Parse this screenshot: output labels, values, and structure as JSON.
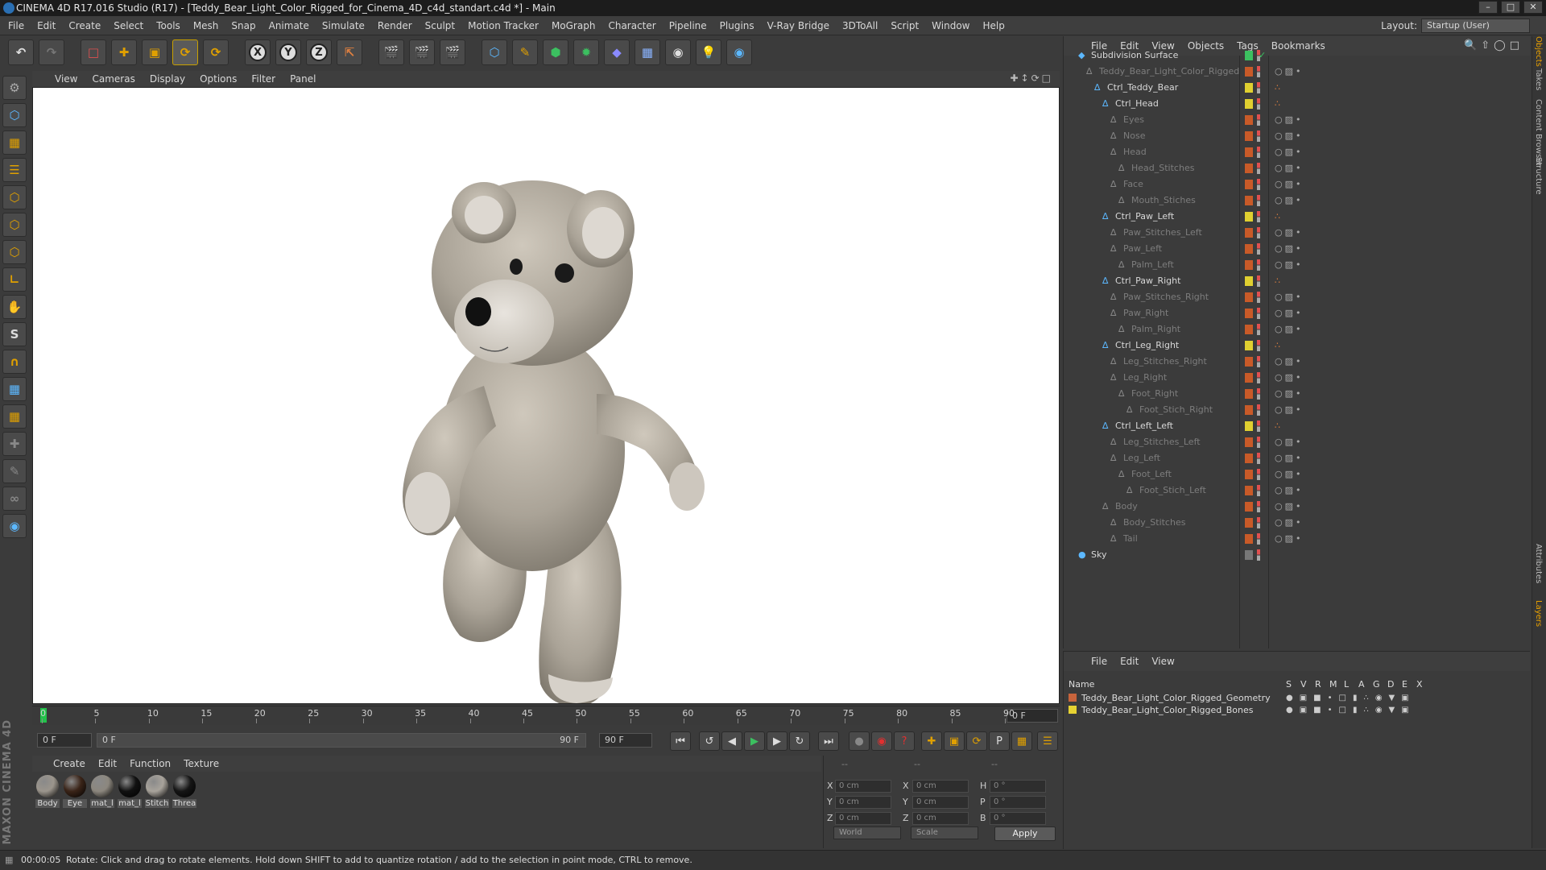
{
  "window": {
    "title": "CINEMA 4D R17.016 Studio (R17) - [Teddy_Bear_Light_Color_Rigged_for_Cinema_4D_c4d_standart.c4d *] - Main"
  },
  "menubar": {
    "items": [
      "File",
      "Edit",
      "Create",
      "Select",
      "Tools",
      "Mesh",
      "Snap",
      "Animate",
      "Simulate",
      "Render",
      "Sculpt",
      "Motion Tracker",
      "MoGraph",
      "Character",
      "Pipeline",
      "Plugins",
      "V-Ray Bridge",
      "3DToAll",
      "Script",
      "Window",
      "Help"
    ],
    "layout_label": "Layout:",
    "layout_value": "Startup (User)"
  },
  "toolbar": {
    "x_label": "X",
    "y_label": "Y",
    "z_label": "Z"
  },
  "viewport": {
    "menu": [
      "View",
      "Cameras",
      "Display",
      "Options",
      "Filter",
      "Panel"
    ]
  },
  "timeline": {
    "ticks": [
      "0",
      "5",
      "10",
      "15",
      "20",
      "25",
      "30",
      "35",
      "40",
      "45",
      "50",
      "55",
      "60",
      "65",
      "70",
      "75",
      "80",
      "85",
      "90"
    ],
    "current_frame": "0 F"
  },
  "transport": {
    "start_field": "0 F",
    "range_start": "0 F",
    "range_end": "90 F",
    "end_field": "90 F"
  },
  "material_manager": {
    "menu": [
      "Create",
      "Edit",
      "Function",
      "Texture"
    ],
    "materials": [
      {
        "label": "Body",
        "color": "#9b958c"
      },
      {
        "label": "Eye",
        "color": "#3a2418"
      },
      {
        "label": "mat_l",
        "color": "#8c877e"
      },
      {
        "label": "mat_l",
        "color": "#111111"
      },
      {
        "label": "Stitch",
        "color": "#a8a39b"
      },
      {
        "label": "Threa",
        "color": "#151515"
      }
    ]
  },
  "coordinates": {
    "header": [
      "--",
      "--",
      "--"
    ],
    "rows": [
      {
        "axis": "X",
        "pos": "0 cm",
        "size_axis": "X",
        "size": "0 cm",
        "rot_axis": "H",
        "rot": "0 °"
      },
      {
        "axis": "Y",
        "pos": "0 cm",
        "size_axis": "Y",
        "size": "0 cm",
        "rot_axis": "P",
        "rot": "0 °"
      },
      {
        "axis": "Z",
        "pos": "0 cm",
        "size_axis": "Z",
        "size": "0 cm",
        "rot_axis": "B",
        "rot": "0 °"
      }
    ],
    "mode_select": "World",
    "scale_select": "Scale",
    "apply_label": "Apply"
  },
  "object_manager": {
    "menu": [
      "File",
      "Edit",
      "View",
      "Objects",
      "Tags",
      "Bookmarks"
    ],
    "objects": [
      {
        "name": "Subdivision Surface",
        "state": "on",
        "tag": "green"
      },
      {
        "name": "Teddy_Bear_Light_Color_Rigged",
        "state": "dim",
        "tag": "orange"
      },
      {
        "name": "Ctrl_Teddy_Bear",
        "state": "on",
        "tag": "yellow"
      },
      {
        "name": "Ctrl_Head",
        "state": "on",
        "tag": "yellow"
      },
      {
        "name": "Eyes",
        "state": "dim",
        "tag": "orange"
      },
      {
        "name": "Nose",
        "state": "dim",
        "tag": "orange"
      },
      {
        "name": "Head",
        "state": "dim",
        "tag": "orange"
      },
      {
        "name": "Head_Stitches",
        "state": "dim",
        "tag": "orange"
      },
      {
        "name": "Face",
        "state": "dim",
        "tag": "orange"
      },
      {
        "name": "Mouth_Stiches",
        "state": "dim",
        "tag": "orange"
      },
      {
        "name": "Ctrl_Paw_Left",
        "state": "on",
        "tag": "yellow"
      },
      {
        "name": "Paw_Stitches_Left",
        "state": "dim",
        "tag": "orange"
      },
      {
        "name": "Paw_Left",
        "state": "dim",
        "tag": "orange"
      },
      {
        "name": "Palm_Left",
        "state": "dim",
        "tag": "orange"
      },
      {
        "name": "Ctrl_Paw_Right",
        "state": "on",
        "tag": "yellow"
      },
      {
        "name": "Paw_Stitches_Right",
        "state": "dim",
        "tag": "orange"
      },
      {
        "name": "Paw_Right",
        "state": "dim",
        "tag": "orange"
      },
      {
        "name": "Palm_Right",
        "state": "dim",
        "tag": "orange"
      },
      {
        "name": "Ctrl_Leg_Right",
        "state": "on",
        "tag": "yellow"
      },
      {
        "name": "Leg_Stitches_Right",
        "state": "dim",
        "tag": "orange"
      },
      {
        "name": "Leg_Right",
        "state": "dim",
        "tag": "orange"
      },
      {
        "name": "Foot_Right",
        "state": "dim",
        "tag": "orange"
      },
      {
        "name": "Foot_Stich_Right",
        "state": "dim",
        "tag": "orange"
      },
      {
        "name": "Ctrl_Left_Left",
        "state": "on",
        "tag": "yellow"
      },
      {
        "name": "Leg_Stitches_Left",
        "state": "dim",
        "tag": "orange"
      },
      {
        "name": "Leg_Left",
        "state": "dim",
        "tag": "orange"
      },
      {
        "name": "Foot_Left",
        "state": "dim",
        "tag": "orange"
      },
      {
        "name": "Foot_Stich_Left",
        "state": "dim",
        "tag": "orange"
      },
      {
        "name": "Body",
        "state": "dim",
        "tag": "orange"
      },
      {
        "name": "Body_Stitches",
        "state": "dim",
        "tag": "orange"
      },
      {
        "name": "Tail",
        "state": "dim",
        "tag": "orange"
      },
      {
        "name": "Sky",
        "state": "on",
        "tag": "grey"
      }
    ]
  },
  "layer_manager": {
    "menu": [
      "File",
      "Edit",
      "View"
    ],
    "header": {
      "name": "Name",
      "cols": [
        "S",
        "V",
        "R",
        "M",
        "L",
        "A",
        "G",
        "D",
        "E",
        "X"
      ]
    },
    "layers": [
      {
        "name": "Teddy_Bear_Light_Color_Rigged_Geometry",
        "color": "#c8643c"
      },
      {
        "name": "Teddy_Bear_Light_Color_Rigged_Bones",
        "color": "#e6d232"
      }
    ]
  },
  "right_tabs": [
    "Objects",
    "Takes",
    "Content Browser",
    "Structure",
    "Attributes",
    "Layers"
  ],
  "status": {
    "time": "00:00:05",
    "message": "Rotate: Click and drag to rotate elements. Hold down SHIFT to add to quantize rotation / add to the selection in point mode, CTRL to remove."
  },
  "maxon_logo": "MAXON CINEMA 4D"
}
